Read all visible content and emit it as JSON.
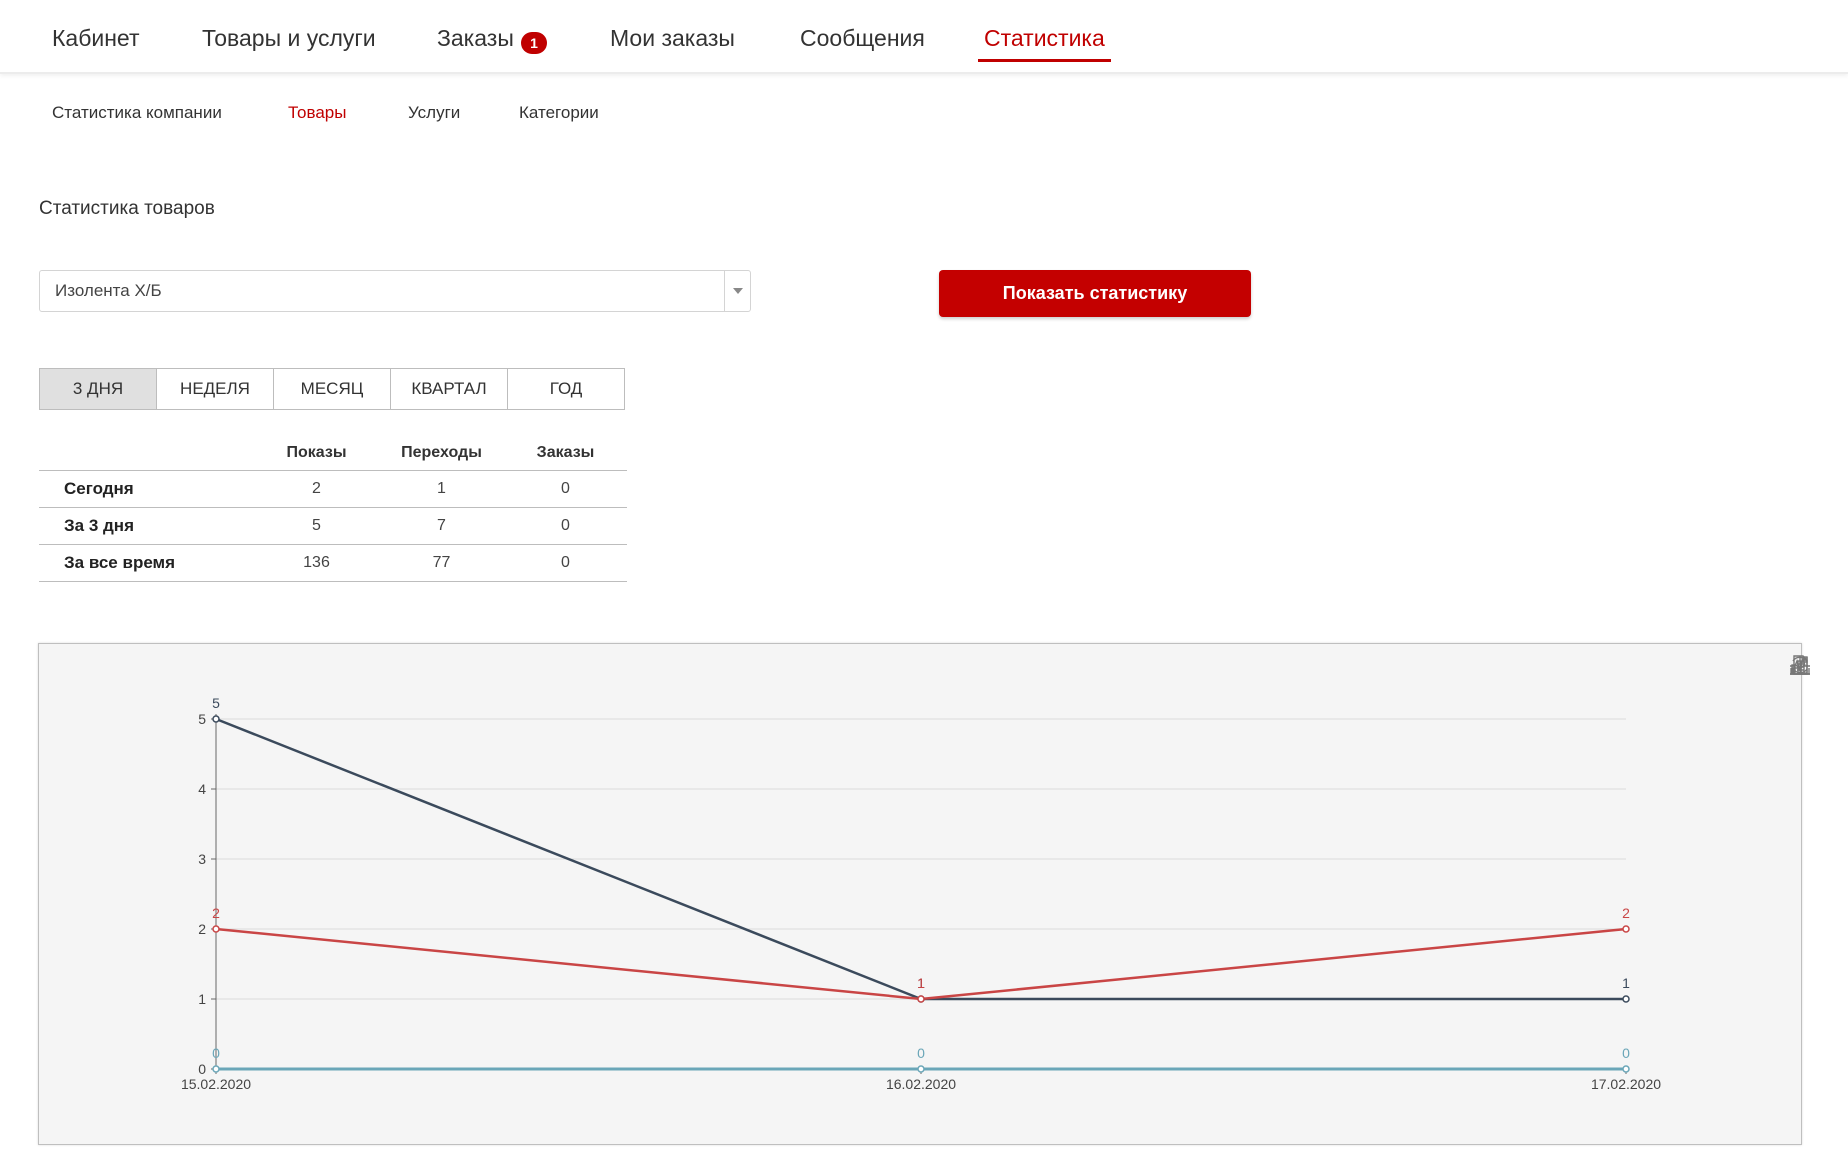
{
  "topnav": {
    "items": [
      {
        "label": "Кабинет"
      },
      {
        "label": "Товары и услуги"
      },
      {
        "label": "Заказы",
        "badge": "1"
      },
      {
        "label": "Мои заказы"
      },
      {
        "label": "Сообщения"
      },
      {
        "label": "Статистика",
        "active": true
      }
    ]
  },
  "subnav": {
    "items": [
      {
        "label": "Статистика компании"
      },
      {
        "label": "Товары",
        "active": true
      },
      {
        "label": "Услуги"
      },
      {
        "label": "Категории"
      }
    ]
  },
  "section_title": "Статистика товаров",
  "product_select": {
    "value": "Изолента Х/Б"
  },
  "show_button": {
    "label": "Показать статистику"
  },
  "periods": {
    "items": [
      "3 ДНЯ",
      "НЕДЕЛЯ",
      "МЕСЯЦ",
      "КВАРТАЛ",
      "ГОД"
    ],
    "active": "3 ДНЯ"
  },
  "stats_table": {
    "headers": [
      "",
      "Показы",
      "Переходы",
      "Заказы"
    ],
    "rows": [
      {
        "label": "Сегодня",
        "values": [
          "2",
          "1",
          "0"
        ]
      },
      {
        "label": "За 3 дня",
        "values": [
          "5",
          "7",
          "0"
        ]
      },
      {
        "label": "За все время",
        "values": [
          "136",
          "77",
          "0"
        ]
      }
    ]
  },
  "chart_tools": [
    "data-view-icon",
    "line-chart-icon",
    "bar-chart-icon",
    "refresh-icon",
    "download-icon"
  ],
  "colors": {
    "accent": "#c00000",
    "series_dark": "#3b4a5c",
    "series_red": "#c94545",
    "series_teal": "#6aa6b8"
  },
  "chart_data": {
    "type": "line",
    "categories": [
      "15.02.2020",
      "16.02.2020",
      "17.02.2020"
    ],
    "ylim": [
      0,
      5
    ],
    "yticks": [
      0,
      1,
      2,
      3,
      4,
      5
    ],
    "grid": true,
    "series": [
      {
        "values": [
          5,
          1,
          1
        ],
        "color": "#3b4a5c"
      },
      {
        "values": [
          2,
          1,
          2
        ],
        "color": "#c94545"
      },
      {
        "values": [
          0,
          0,
          0
        ],
        "color": "#6aa6b8"
      }
    ]
  }
}
